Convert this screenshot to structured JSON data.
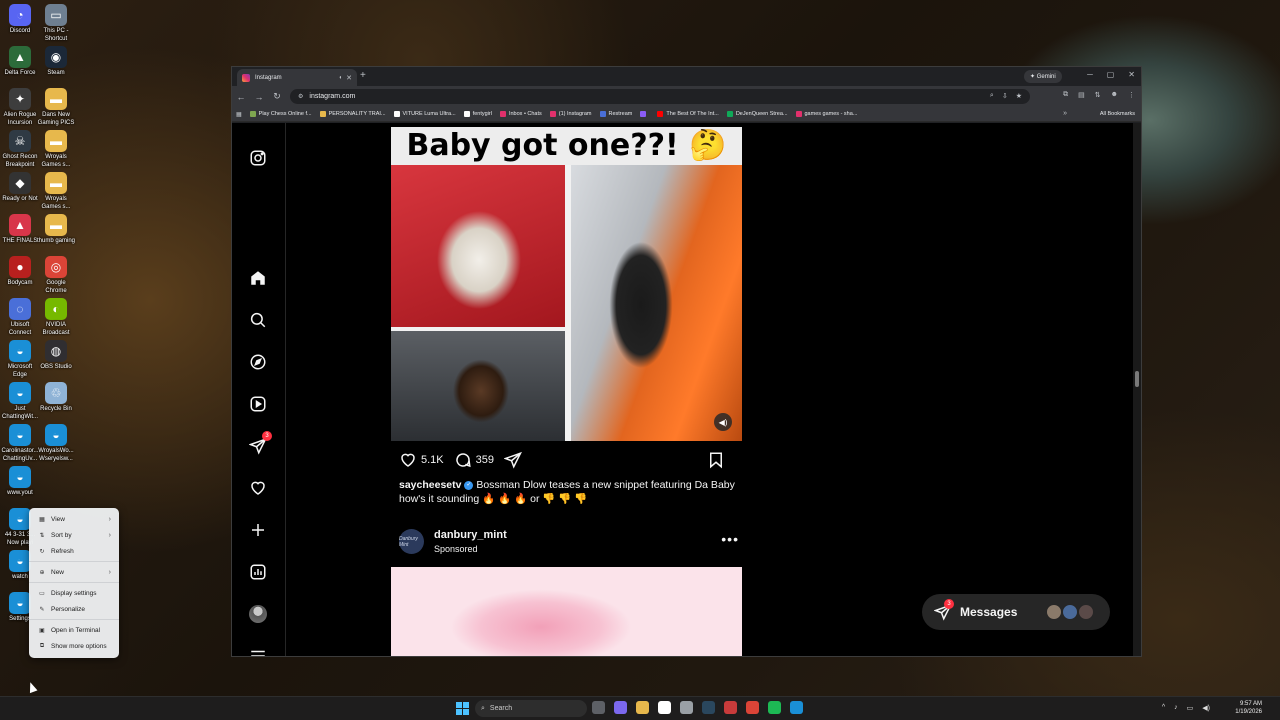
{
  "desktop": {
    "icons": [
      {
        "label": "Discord",
        "icon": "discord-icon",
        "color": "#5865f2",
        "glyph": "◔"
      },
      {
        "label": "This PC - Shortcut",
        "icon": "this-pc-icon",
        "color": "#6e7f91",
        "glyph": "▭"
      },
      {
        "label": "Delta Force",
        "icon": "delta-force-icon",
        "color": "#2c6b3a",
        "glyph": "▲"
      },
      {
        "label": "Steam",
        "icon": "steam-icon",
        "color": "#1b2838",
        "glyph": "◉"
      },
      {
        "label": "Alien Rogue Incursion",
        "icon": "alien-rogue-icon",
        "color": "#3d3d3d",
        "glyph": "✦"
      },
      {
        "label": "Dans New Gaming PICS",
        "icon": "folder-icon",
        "color": "#e7b84c",
        "glyph": "▬"
      },
      {
        "label": "Ghost Recon Breakpoint",
        "icon": "ghost-recon-icon",
        "color": "#2f3a44",
        "glyph": "☠"
      },
      {
        "label": "Wroyals Games s...",
        "icon": "folder-icon",
        "color": "#e7b84c",
        "glyph": "▬"
      },
      {
        "label": "Ready or Not",
        "icon": "ready-or-not-icon",
        "color": "#333",
        "glyph": "◆"
      },
      {
        "label": "Wroyals Games s...",
        "icon": "folder-icon",
        "color": "#e7b84c",
        "glyph": "▬"
      },
      {
        "label": "THE FINALS",
        "icon": "the-finals-icon",
        "color": "#d8364a",
        "glyph": "▲"
      },
      {
        "label": "thumb gaming",
        "icon": "folder-icon",
        "color": "#e7b84c",
        "glyph": "▬"
      },
      {
        "label": "Bodycam",
        "icon": "bodycam-icon",
        "color": "#b8201e",
        "glyph": "●"
      },
      {
        "label": "Google Chrome",
        "icon": "chrome-icon",
        "color": "#db4437",
        "glyph": "◎"
      },
      {
        "label": "Ubisoft Connect",
        "icon": "ubisoft-icon",
        "color": "#4a6fd8",
        "glyph": "◌"
      },
      {
        "label": "NVIDIA Broadcast",
        "icon": "nvidia-icon",
        "color": "#76b900",
        "glyph": "◐"
      },
      {
        "label": "Microsoft Edge",
        "icon": "edge-icon",
        "color": "#1a8fd6",
        "glyph": "◒"
      },
      {
        "label": "OBS Studio",
        "icon": "obs-icon",
        "color": "#302e31",
        "glyph": "◍"
      },
      {
        "label": "Just ChattingWit...",
        "icon": "edge-icon",
        "color": "#1a8fd6",
        "glyph": "◒"
      },
      {
        "label": "Recycle Bin",
        "icon": "recycle-bin-icon",
        "color": "#8fb3d6",
        "glyph": "♲"
      },
      {
        "label": "Carolinastor... ChattingUv...",
        "icon": "edge-icon",
        "color": "#1a8fd6",
        "glyph": "◒"
      },
      {
        "label": "WroyalsWo... Wseryelsw...",
        "icon": "edge-icon",
        "color": "#1a8fd6",
        "glyph": "◒"
      },
      {
        "label": "www.yout",
        "icon": "edge-icon",
        "color": "#1a8fd6",
        "glyph": "◒"
      },
      {
        "label": "44 3-31 3... Now playi",
        "icon": "edge-icon",
        "color": "#1a8fd6",
        "glyph": "◒"
      },
      {
        "label": "watch",
        "icon": "edge-icon",
        "color": "#1a8fd6",
        "glyph": "◒"
      },
      {
        "label": "Settings",
        "icon": "edge-icon",
        "color": "#1a8fd6",
        "glyph": "◒"
      }
    ]
  },
  "browser": {
    "tab_title": "Instagram",
    "new_tab": "+",
    "gemini_label": "Gemini",
    "url": "instagram.com",
    "bookmarks": [
      {
        "label": "Play Chess Online f...",
        "color": "#7fa650"
      },
      {
        "label": "PERSONALITY TRAI...",
        "color": "#e7b84c"
      },
      {
        "label": "VITURE Luma Ultra...",
        "color": "#ffffff"
      },
      {
        "label": "fentygirl",
        "color": "#ffffff"
      },
      {
        "label": "Inbox • Chats",
        "color": "#e1306c"
      },
      {
        "label": "(1) Instagram",
        "color": "#e1306c"
      },
      {
        "label": "Restream",
        "color": "#4a6fd8"
      },
      {
        "label": "",
        "color": "#8a5cf6"
      },
      {
        "label": "The Best Of The Int...",
        "color": "#ff0000"
      },
      {
        "label": "DeJenQueen Strea...",
        "color": "#0fa958"
      },
      {
        "label": "games games - sha...",
        "color": "#e1306c"
      }
    ],
    "all_bookmarks": "All Bookmarks"
  },
  "instagram": {
    "notification_badge": "3",
    "post": {
      "banner_text": "Baby got one??! 🤔",
      "likes": "5.1K",
      "comments": "359",
      "username": "saycheesetv",
      "caption": "Bossman Dlow teases a new snippet featuring Da Baby how's it sounding 🔥 🔥 🔥 or 👎 👎 👎"
    },
    "sponsored": {
      "avatar_text": "Danbury Mint",
      "username": "danbury_mint",
      "tag": "Sponsored",
      "more": "•••"
    },
    "messages": {
      "label": "Messages",
      "badge": "3"
    }
  },
  "context_menu": {
    "items": [
      {
        "label": "View",
        "icon": "view-icon",
        "glyph": "▦",
        "submenu": true
      },
      {
        "label": "Sort by",
        "icon": "sort-icon",
        "glyph": "⇅",
        "submenu": true
      },
      {
        "label": "Refresh",
        "icon": "refresh-icon",
        "glyph": "↻",
        "submenu": false
      },
      {
        "label": "New",
        "icon": "new-icon",
        "glyph": "⊕",
        "submenu": true
      },
      {
        "label": "Display settings",
        "icon": "display-settings-icon",
        "glyph": "▭",
        "submenu": false
      },
      {
        "label": "Personalize",
        "icon": "personalize-icon",
        "glyph": "✎",
        "submenu": false
      },
      {
        "label": "Open in Terminal",
        "icon": "terminal-icon",
        "glyph": "▣",
        "submenu": false
      },
      {
        "label": "Show more options",
        "icon": "more-options-icon",
        "glyph": "⧉",
        "submenu": false
      }
    ]
  },
  "taskbar": {
    "search_placeholder": "Search",
    "time": "9:57 AM",
    "date": "1/19/2026",
    "apps": [
      {
        "icon": "file-explorer-icon",
        "color": "#5d6066"
      },
      {
        "icon": "copilot-icon",
        "color": "#7b68ee"
      },
      {
        "icon": "folder-icon",
        "color": "#e7b84c"
      },
      {
        "icon": "store-icon",
        "color": "#ffffff"
      },
      {
        "icon": "settings-icon",
        "color": "#9aa0a6"
      },
      {
        "icon": "steam-icon",
        "color": "#2a475e"
      },
      {
        "icon": "game-icon",
        "color": "#c83b3b"
      },
      {
        "icon": "chrome-icon",
        "color": "#db4437"
      },
      {
        "icon": "spotify-icon",
        "color": "#1db954"
      },
      {
        "icon": "edge-icon",
        "color": "#1a8fd6"
      }
    ]
  }
}
